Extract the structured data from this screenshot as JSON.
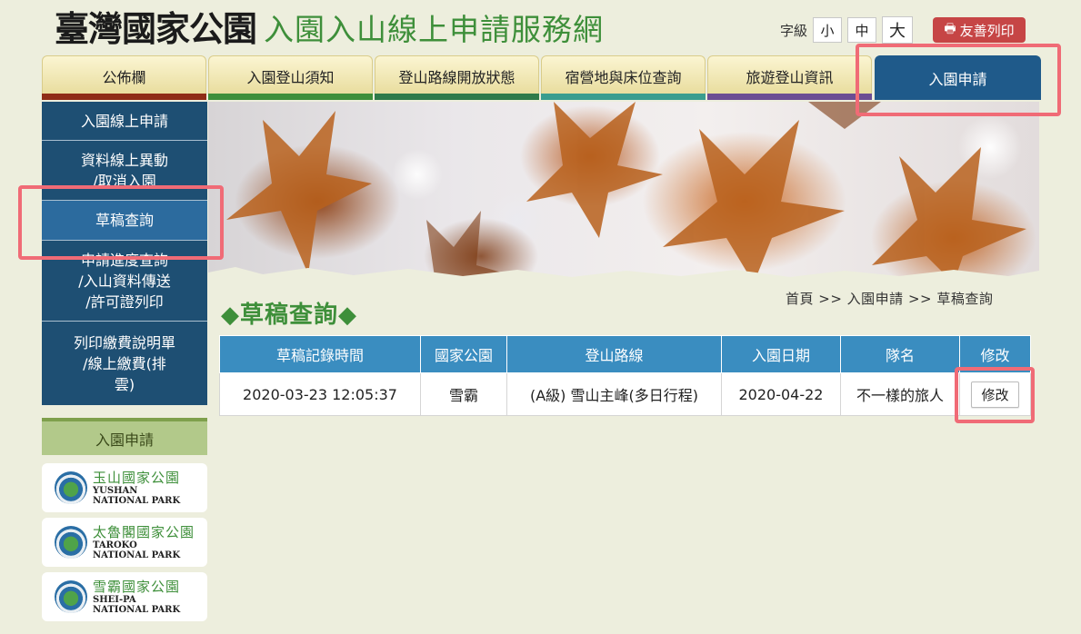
{
  "header": {
    "logo_text": "臺灣國家公園",
    "site_title": "入園入山線上申請服務網",
    "font_size_label": "字級",
    "font_sizes": [
      "小",
      "中",
      "大"
    ],
    "print_label": "友善列印"
  },
  "nav": {
    "tabs": [
      {
        "label": "公佈欄",
        "bar": "#8f2c17"
      },
      {
        "label": "入園登山須知",
        "bar": "#3e8f3a"
      },
      {
        "label": "登山路線開放狀態",
        "bar": "#2f7a4a"
      },
      {
        "label": "宿營地與床位查詢",
        "bar": "#3a9d8f"
      },
      {
        "label": "旅遊登山資訊",
        "bar": "#6c4d93"
      },
      {
        "label": "入園申請",
        "bar": "#1f5a8a"
      }
    ]
  },
  "sidebar": {
    "items": [
      {
        "lines": [
          "入園線上申請"
        ]
      },
      {
        "lines": [
          "資料線上異動",
          "/取消入園"
        ]
      },
      {
        "lines": [
          "草稿查詢"
        ]
      },
      {
        "lines": [
          "申請進度查詢",
          "/入山資料傳送",
          "/許可證列印"
        ]
      },
      {
        "lines": [
          "列印繳費說明單",
          "/線上繳費(排",
          "雲)"
        ]
      }
    ],
    "section_title": "入園申請",
    "parks": [
      {
        "zh": "玉山國家公園",
        "en1": "YUSHAN",
        "en2": "NATIONAL PARK"
      },
      {
        "zh": "太魯閣國家公園",
        "en1": "TAROKO",
        "en2": "NATIONAL PARK"
      },
      {
        "zh": "雪霸國家公園",
        "en1": "SHEI-PA",
        "en2": "NATIONAL PARK"
      }
    ]
  },
  "main": {
    "title": "◆草稿查詢◆",
    "breadcrumb": "首頁 >> 入園申請 >> 草稿查詢",
    "table": {
      "headers": [
        "草稿記錄時間",
        "國家公園",
        "登山路線",
        "入園日期",
        "隊名",
        "修改"
      ],
      "rows": [
        [
          "2020-03-23 12:05:37",
          "雪霸",
          "(A級) 雪山主峰(多日行程)",
          "2020-04-22",
          "不一樣的旅人"
        ]
      ],
      "edit_label": "修改"
    }
  },
  "colors": {
    "primary": "#1f5a8a",
    "accent_green": "#3e8f3a",
    "highlight": "#f06b76",
    "table_header": "#3a8dc0"
  }
}
